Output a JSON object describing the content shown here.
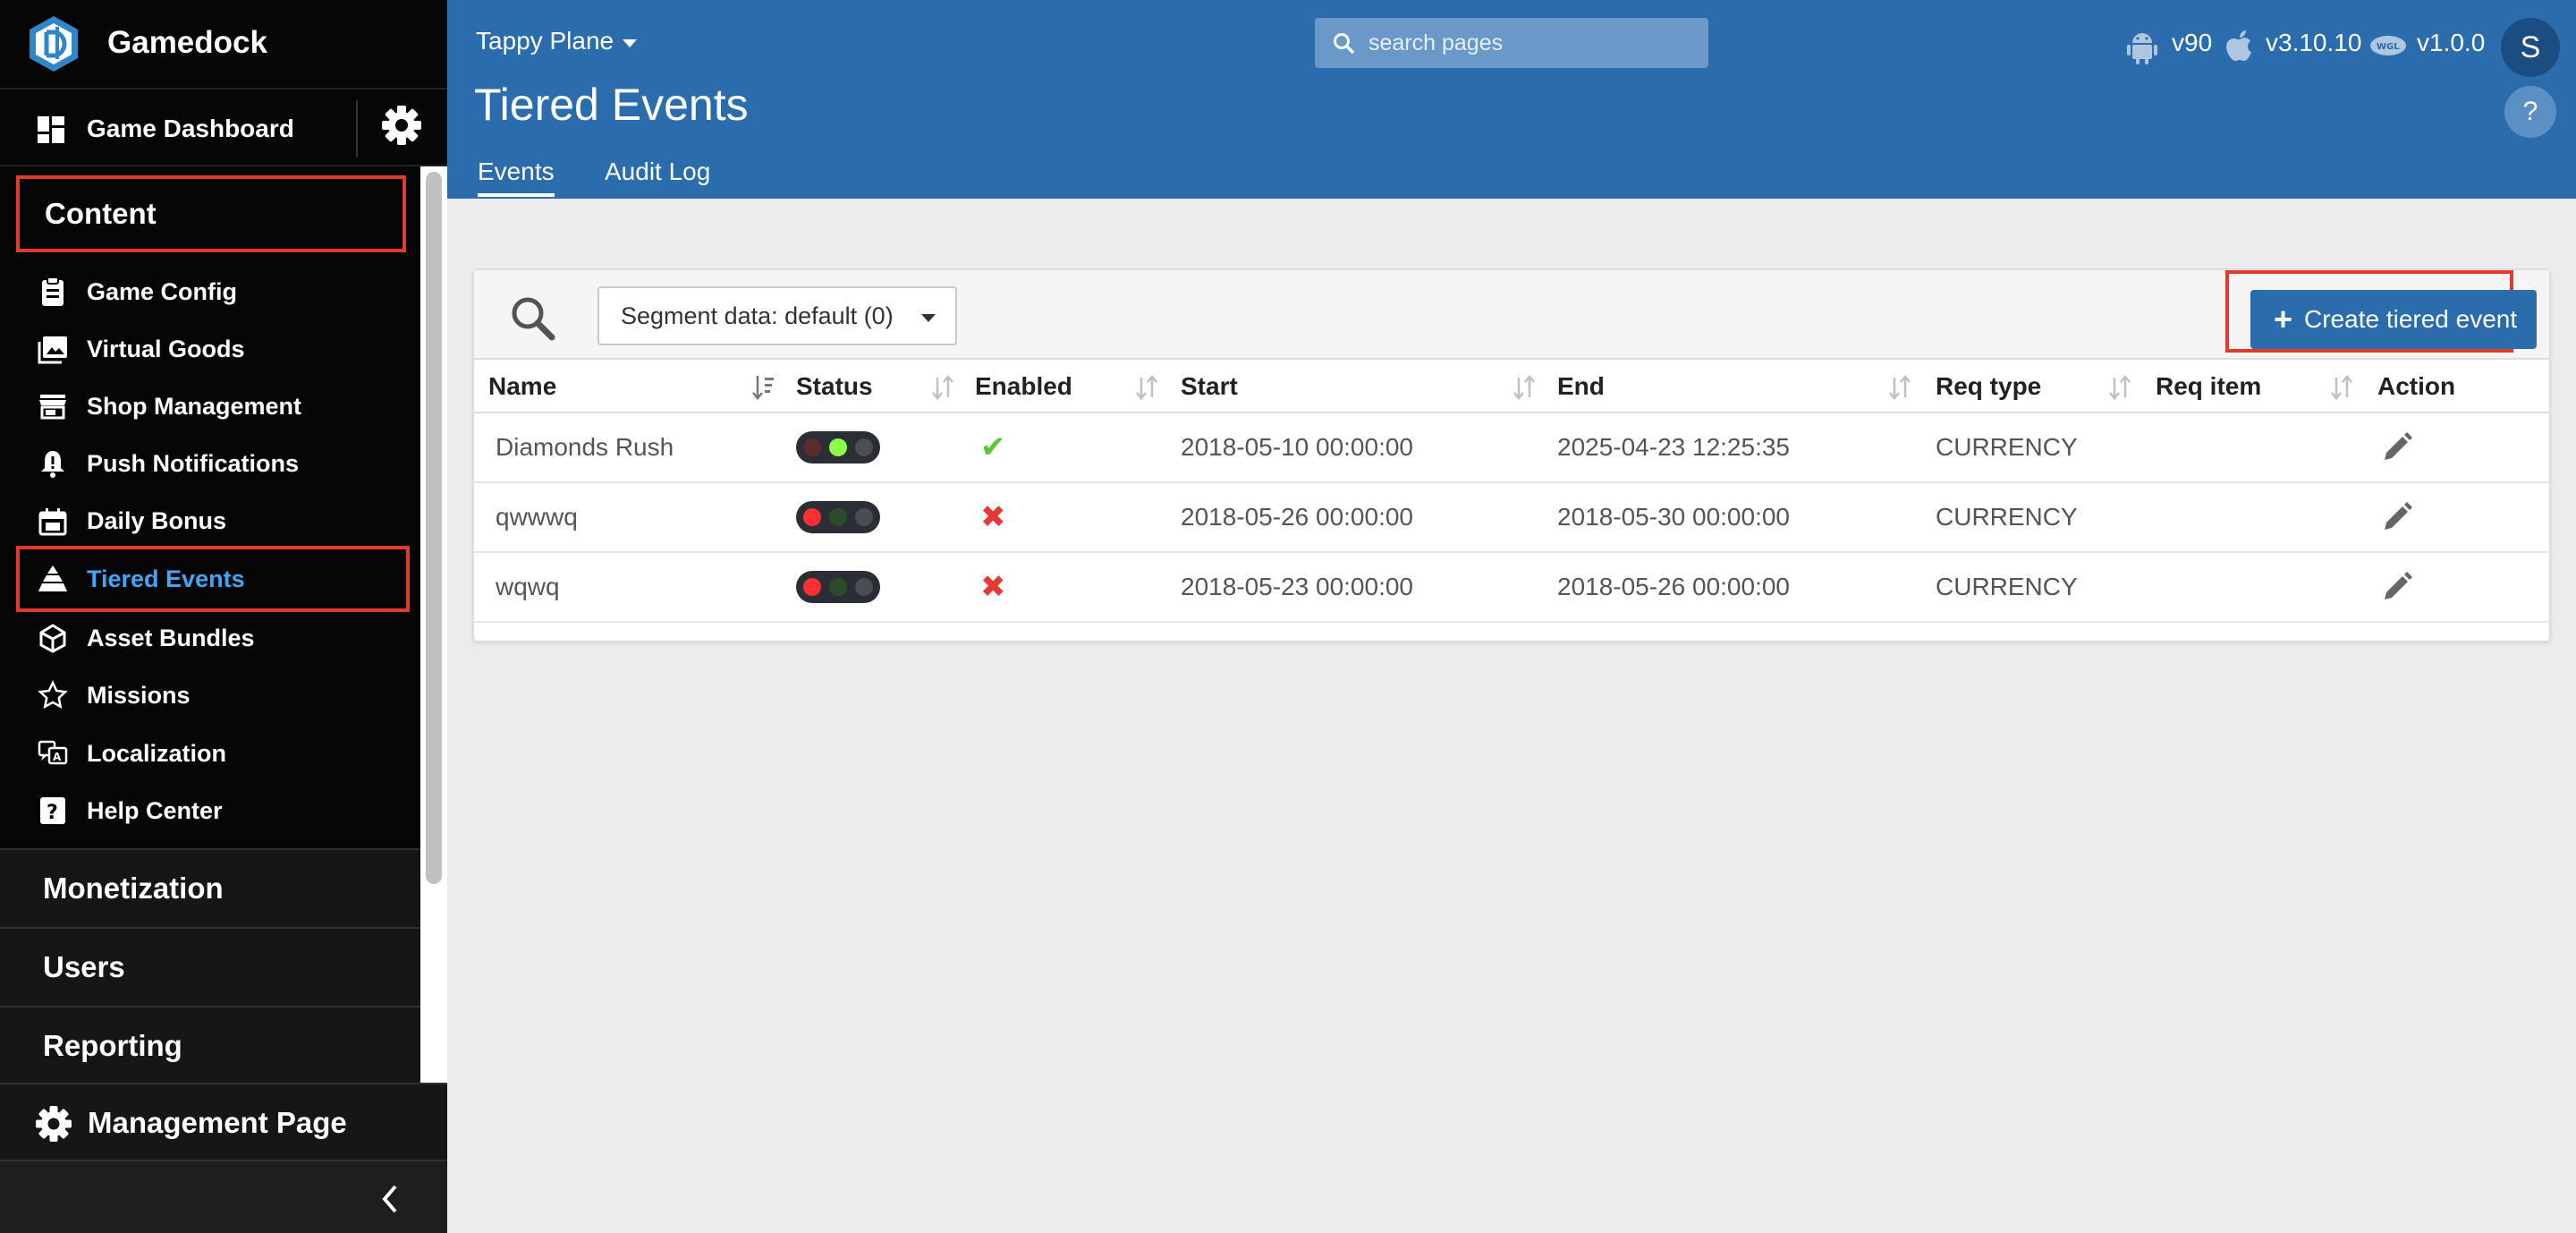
{
  "brand": {
    "name": "Gamedock"
  },
  "sidebar": {
    "dashboard_label": "Game Dashboard",
    "content_label": "Content",
    "items": [
      {
        "label": "Game Config",
        "icon": "clipboard-icon"
      },
      {
        "label": "Virtual Goods",
        "icon": "images-icon"
      },
      {
        "label": "Shop Management",
        "icon": "store-icon"
      },
      {
        "label": "Push Notifications",
        "icon": "bell-icon"
      },
      {
        "label": "Daily Bonus",
        "icon": "calendar-gift-icon"
      },
      {
        "label": "Tiered Events",
        "icon": "pyramid-icon",
        "active": true
      },
      {
        "label": "Asset Bundles",
        "icon": "unity-icon"
      },
      {
        "label": "Missions",
        "icon": "star-icon"
      },
      {
        "label": "Localization",
        "icon": "translate-icon"
      },
      {
        "label": "Help Center",
        "icon": "help-icon"
      }
    ],
    "sections": [
      "Monetization",
      "Users",
      "Reporting"
    ],
    "management_label": "Management Page"
  },
  "header": {
    "project": "Tappy Plane",
    "search_placeholder": "search pages",
    "versions": {
      "android": "v90",
      "ios": "v3.10.10",
      "webgl": "v1.0.0"
    },
    "avatar_initial": "S",
    "page_title": "Tiered Events",
    "help": "?",
    "tabs": [
      "Events",
      "Audit Log"
    ]
  },
  "toolbar": {
    "segment_label": "Segment data: default (0)",
    "create_label": "Create tiered event",
    "create_plus": "+"
  },
  "table": {
    "columns": [
      "Name",
      "Status",
      "Enabled",
      "Start",
      "End",
      "Req type",
      "Req item",
      "Action"
    ],
    "rows": [
      {
        "name": "Diamonds Rush",
        "status": "active",
        "enabled": "✔",
        "start": "2018-05-10 00:00:00",
        "end": "2025-04-23 12:25:35",
        "req_type": "CURRENCY",
        "req_item": ""
      },
      {
        "name": "qwwwq",
        "status": "stopped",
        "enabled": "✖",
        "start": "2018-05-26 00:00:00",
        "end": "2018-05-30 00:00:00",
        "req_type": "CURRENCY",
        "req_item": ""
      },
      {
        "name": "wqwq",
        "status": "stopped",
        "enabled": "✖",
        "start": "2018-05-23 00:00:00",
        "end": "2018-05-26 00:00:00",
        "req_type": "CURRENCY",
        "req_item": ""
      }
    ]
  },
  "colors": {
    "header_blue": "#2b6cad",
    "active_nav": "#42a5f5",
    "highlight_red": "#e13b2c",
    "enabled_green": "#5cc83a",
    "disabled_red": "#e53935"
  }
}
